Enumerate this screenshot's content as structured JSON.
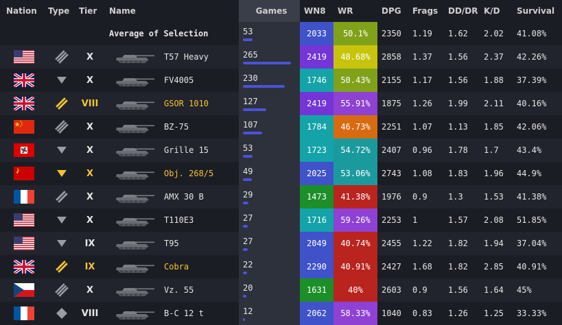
{
  "colors": {
    "background": "#1b1d24",
    "games_column": "#2d313b",
    "games_bar": "#4c52d8",
    "premium_gold": "#f4c430",
    "wn8_purple": "#7335d6",
    "wn8_blue": "#3f52c9",
    "wn8_teal": "#14a3a8",
    "wn8_green": "#1c8f28",
    "wr_red": "#b9241f",
    "wr_orange": "#d76b12",
    "wr_yellow": "#c8c40e",
    "wr_lime": "#80a21a",
    "wr_teal": "#1b9a9e",
    "wr_purple": "#8e41d2"
  },
  "headers": {
    "nation": "Nation",
    "type": "Type",
    "tier": "Tier",
    "name": "Name",
    "games": "Games",
    "wn8": "WN8",
    "wr": "WR",
    "dpg": "DPG",
    "frags": "Frags",
    "dmg_ratio": "DD/DR",
    "kd": "K/D",
    "survival": "Survival"
  },
  "average": {
    "label": "Average of Selection",
    "games": "53",
    "games_fraction": 0.2,
    "wn8": "2033",
    "wn8_color": "#3f52c9",
    "wr": "50.1%",
    "wr_color": "#80a21a",
    "dpg": "2350",
    "frags": "1.19",
    "dmg_ratio": "1.62",
    "kd": "2.02",
    "survival": "41.08%"
  },
  "rows": [
    {
      "nation": "usa",
      "type": "heavy-tank-icon",
      "premium": false,
      "tier": "X",
      "name": "T57 Heavy",
      "games": "265",
      "games_fraction": 1.0,
      "wn8": "2419",
      "wn8_color": "#7335d6",
      "wr": "48.68%",
      "wr_color": "#c8c40e",
      "dpg": "2858",
      "frags": "1.37",
      "dmg_ratio": "1.56",
      "kd": "2.37",
      "survival": "42.26%"
    },
    {
      "nation": "uk",
      "type": "td-icon",
      "premium": false,
      "tier": "X",
      "name": "FV4005",
      "games": "230",
      "games_fraction": 0.87,
      "wn8": "1746",
      "wn8_color": "#14a3a8",
      "wr": "50.43%",
      "wr_color": "#80a21a",
      "dpg": "2155",
      "frags": "1.17",
      "dmg_ratio": "1.56",
      "kd": "1.88",
      "survival": "37.39%"
    },
    {
      "nation": "uk",
      "type": "medium-tank-icon",
      "premium": true,
      "tier": "VIII",
      "name": "GSOR 1010",
      "games": "127",
      "games_fraction": 0.48,
      "wn8": "2419",
      "wn8_color": "#7335d6",
      "wr": "55.91%",
      "wr_color": "#8e41d2",
      "dpg": "1875",
      "frags": "1.26",
      "dmg_ratio": "1.99",
      "kd": "2.11",
      "survival": "40.16%"
    },
    {
      "nation": "china",
      "type": "heavy-tank-icon",
      "premium": false,
      "tier": "X",
      "name": "BZ-75",
      "games": "107",
      "games_fraction": 0.4,
      "wn8": "1784",
      "wn8_color": "#14a3a8",
      "wr": "46.73%",
      "wr_color": "#d76b12",
      "dpg": "2251",
      "frags": "1.07",
      "dmg_ratio": "1.13",
      "kd": "1.85",
      "survival": "42.06%"
    },
    {
      "nation": "germany",
      "type": "td-icon",
      "premium": false,
      "tier": "X",
      "name": "Grille 15",
      "games": "53",
      "games_fraction": 0.2,
      "wn8": "1723",
      "wn8_color": "#14a3a8",
      "wr": "54.72%",
      "wr_color": "#1b9a9e",
      "dpg": "2407",
      "frags": "0.96",
      "dmg_ratio": "1.78",
      "kd": "1.7",
      "survival": "43.4%"
    },
    {
      "nation": "ussr",
      "type": "td-icon",
      "premium": true,
      "tier": "X",
      "name": "Obj. 268/5",
      "games": "49",
      "games_fraction": 0.18,
      "wn8": "2025",
      "wn8_color": "#3f52c9",
      "wr": "53.06%",
      "wr_color": "#1b9a9e",
      "dpg": "2743",
      "frags": "1.08",
      "dmg_ratio": "1.83",
      "kd": "1.96",
      "survival": "44.9%"
    },
    {
      "nation": "france",
      "type": "medium-tank-icon",
      "premium": false,
      "tier": "X",
      "name": "AMX 30 B",
      "games": "29",
      "games_fraction": 0.11,
      "wn8": "1473",
      "wn8_color": "#1c8f28",
      "wr": "41.38%",
      "wr_color": "#b9241f",
      "dpg": "1976",
      "frags": "0.9",
      "dmg_ratio": "1.3",
      "kd": "1.53",
      "survival": "41.38%"
    },
    {
      "nation": "usa",
      "type": "td-icon",
      "premium": false,
      "tier": "X",
      "name": "T110E3",
      "games": "27",
      "games_fraction": 0.1,
      "wn8": "1716",
      "wn8_color": "#14a3a8",
      "wr": "59.26%",
      "wr_color": "#8e41d2",
      "dpg": "2253",
      "frags": "1",
      "dmg_ratio": "1.57",
      "kd": "2.08",
      "survival": "51.85%"
    },
    {
      "nation": "usa",
      "type": "td-icon",
      "premium": false,
      "tier": "IX",
      "name": "T95",
      "games": "27",
      "games_fraction": 0.1,
      "wn8": "2049",
      "wn8_color": "#3f52c9",
      "wr": "40.74%",
      "wr_color": "#b9241f",
      "dpg": "2455",
      "frags": "1.22",
      "dmg_ratio": "1.82",
      "kd": "1.94",
      "survival": "37.04%"
    },
    {
      "nation": "uk",
      "type": "medium-tank-icon",
      "premium": true,
      "tier": "IX",
      "name": "Cobra",
      "games": "22",
      "games_fraction": 0.08,
      "wn8": "2290",
      "wn8_color": "#3f52c9",
      "wr": "40.91%",
      "wr_color": "#b9241f",
      "dpg": "2427",
      "frags": "1.68",
      "dmg_ratio": "1.82",
      "kd": "2.85",
      "survival": "40.91%"
    },
    {
      "nation": "czech",
      "type": "heavy-tank-icon",
      "premium": false,
      "tier": "X",
      "name": "Vz. 55",
      "games": "20",
      "games_fraction": 0.075,
      "wn8": "1631",
      "wn8_color": "#1c8f28",
      "wr": "40%",
      "wr_color": "#b9241f",
      "dpg": "2603",
      "frags": "0.9",
      "dmg_ratio": "1.56",
      "kd": "1.64",
      "survival": "45%"
    },
    {
      "nation": "france",
      "type": "light-tank-icon",
      "premium": false,
      "tier": "VIII",
      "name": "B-C 12 t",
      "games": "12",
      "games_fraction": 0.045,
      "wn8": "2062",
      "wn8_color": "#3f52c9",
      "wr": "58.33%",
      "wr_color": "#8e41d2",
      "dpg": "1040",
      "frags": "0.83",
      "dmg_ratio": "1.26",
      "kd": "1.25",
      "survival": "33.33%"
    }
  ]
}
